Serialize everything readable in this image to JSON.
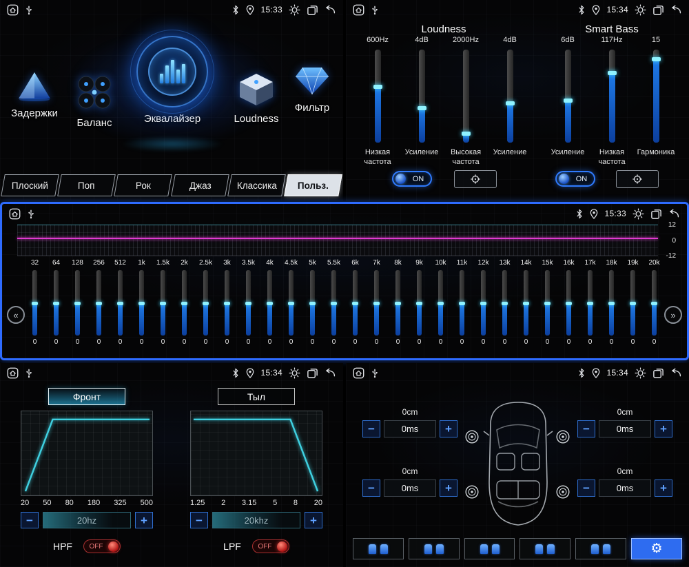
{
  "accent": {
    "blue": "#2e6cf0",
    "cyan": "#3fd0e0",
    "magenta": "#e03ad0",
    "red": "#c01818"
  },
  "icons": {
    "minus": "−",
    "plus": "+",
    "prev": "«",
    "next": "»",
    "gear": "⚙"
  },
  "status_times": {
    "main_menu": "15:33",
    "loudness": "15:34",
    "equalizer": "15:33",
    "filter": "15:34",
    "delay": "15:34"
  },
  "main_menu": {
    "items": [
      {
        "label": "Задержки"
      },
      {
        "label": "Баланс"
      },
      {
        "label": "Эквалайзер"
      },
      {
        "label": "Loudness"
      },
      {
        "label": "Фильтр"
      }
    ],
    "presets": [
      {
        "label": "Плоский"
      },
      {
        "label": "Поп"
      },
      {
        "label": "Рок"
      },
      {
        "label": "Джаз"
      },
      {
        "label": "Классика"
      },
      {
        "label": "Польз."
      }
    ],
    "active_preset": "Польз."
  },
  "loudness_panel": {
    "sections": [
      {
        "title": "Loudness"
      },
      {
        "title": "Smart Bass"
      }
    ],
    "sliders": [
      {
        "value": "600Hz",
        "label": "Низкая частота",
        "fill": 60
      },
      {
        "value": "4dB",
        "label": "Усиление",
        "fill": 37
      },
      {
        "value": "2000Hz",
        "label": "Высокая частота",
        "fill": 10
      },
      {
        "value": "4dB",
        "label": "Усиление",
        "fill": 42
      },
      {
        "value": "6dB",
        "label": "Усиление",
        "fill": 45
      },
      {
        "value": "117Hz",
        "label": "Низкая частота",
        "fill": 75
      },
      {
        "value": "15",
        "label": "Гармоника",
        "fill": 90
      }
    ],
    "toggles": [
      {
        "label": "ON"
      },
      {
        "label": "ON"
      }
    ]
  },
  "equalizer": {
    "scale": [
      "12",
      "0",
      "-12"
    ],
    "bands": [
      {
        "freq": "32",
        "value": "0",
        "fill": 50
      },
      {
        "freq": "64",
        "value": "0",
        "fill": 50
      },
      {
        "freq": "128",
        "value": "0",
        "fill": 50
      },
      {
        "freq": "256",
        "value": "0",
        "fill": 50
      },
      {
        "freq": "512",
        "value": "0",
        "fill": 50
      },
      {
        "freq": "1k",
        "value": "0",
        "fill": 50
      },
      {
        "freq": "1.5k",
        "value": "0",
        "fill": 50
      },
      {
        "freq": "2k",
        "value": "0",
        "fill": 50
      },
      {
        "freq": "2.5k",
        "value": "0",
        "fill": 50
      },
      {
        "freq": "3k",
        "value": "0",
        "fill": 50
      },
      {
        "freq": "3.5k",
        "value": "0",
        "fill": 50
      },
      {
        "freq": "4k",
        "value": "0",
        "fill": 50
      },
      {
        "freq": "4.5k",
        "value": "0",
        "fill": 50
      },
      {
        "freq": "5k",
        "value": "0",
        "fill": 50
      },
      {
        "freq": "5.5k",
        "value": "0",
        "fill": 50
      },
      {
        "freq": "6k",
        "value": "0",
        "fill": 50
      },
      {
        "freq": "7k",
        "value": "0",
        "fill": 50
      },
      {
        "freq": "8k",
        "value": "0",
        "fill": 50
      },
      {
        "freq": "9k",
        "value": "0",
        "fill": 50
      },
      {
        "freq": "10k",
        "value": "0",
        "fill": 50
      },
      {
        "freq": "11k",
        "value": "0",
        "fill": 50
      },
      {
        "freq": "12k",
        "value": "0",
        "fill": 50
      },
      {
        "freq": "13k",
        "value": "0",
        "fill": 50
      },
      {
        "freq": "14k",
        "value": "0",
        "fill": 50
      },
      {
        "freq": "15k",
        "value": "0",
        "fill": 50
      },
      {
        "freq": "16k",
        "value": "0",
        "fill": 50
      },
      {
        "freq": "17k",
        "value": "0",
        "fill": 50
      },
      {
        "freq": "18k",
        "value": "0",
        "fill": 50
      },
      {
        "freq": "19k",
        "value": "0",
        "fill": 50
      },
      {
        "freq": "20k",
        "value": "0",
        "fill": 50
      }
    ]
  },
  "filter_panel": {
    "tabs": [
      {
        "label": "Фронт"
      },
      {
        "label": "Тыл"
      }
    ],
    "active_tab": "Фронт",
    "hpf": {
      "name": "HPF",
      "axis": [
        "20",
        "50",
        "80",
        "180",
        "325",
        "500"
      ],
      "value": "20hz",
      "state": "OFF"
    },
    "lpf": {
      "name": "LPF",
      "axis": [
        "1.25",
        "2",
        "3.15",
        "5",
        "8",
        "20"
      ],
      "value": "20khz",
      "state": "OFF"
    }
  },
  "delay_panel": {
    "corners": [
      {
        "dist": "0cm",
        "delay": "0ms"
      },
      {
        "dist": "0cm",
        "delay": "0ms"
      },
      {
        "dist": "0cm",
        "delay": "0ms"
      },
      {
        "dist": "0cm",
        "delay": "0ms"
      }
    ]
  }
}
